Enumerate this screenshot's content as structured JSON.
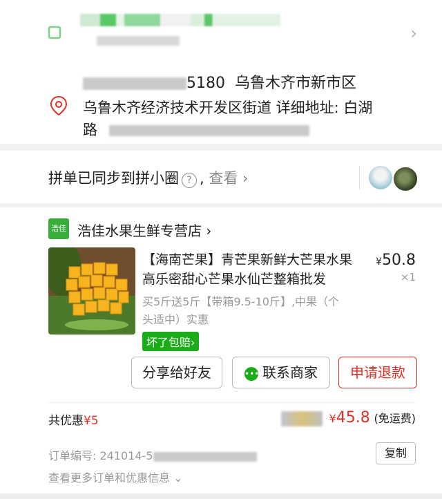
{
  "address": {
    "phone_suffix": "5180",
    "region": "乌鲁木齐市新市区",
    "line2": "乌鲁木齐经济技术开发区街道 详细地址: 白湖",
    "line3": "路"
  },
  "sync": {
    "text": "拼单已同步到拼小圈",
    "view": "查看",
    "chevron": "›"
  },
  "store": {
    "logo": "浩佳",
    "name": "浩佳水果生鲜专营店",
    "chevron": "›"
  },
  "product": {
    "title": "【海南芒果】青芒果新鲜大芒果水果高乐密甜心芒果水仙芒整箱批发",
    "price_symbol": "¥",
    "price": "50.8",
    "qty": "×1",
    "spec": "买5斤送5斤【带箱9.5-10斤】,中果（个头适中）实惠",
    "tag": "坏了包赔"
  },
  "buttons": {
    "share": "分享给好友",
    "contact": "联系商家",
    "refund": "申请退款"
  },
  "summary": {
    "discount_label": "共优惠",
    "discount_value": "¥5",
    "total_symbol": "¥",
    "total": "45.8",
    "shipping": "(免运费)"
  },
  "order": {
    "number_label": "订单编号:",
    "number_visible": "241014-5",
    "copy": "复制",
    "more": "查看更多订单和优惠信息"
  },
  "colors": {
    "accent_red": "#e02e24",
    "accent_green": "#1aad19"
  }
}
